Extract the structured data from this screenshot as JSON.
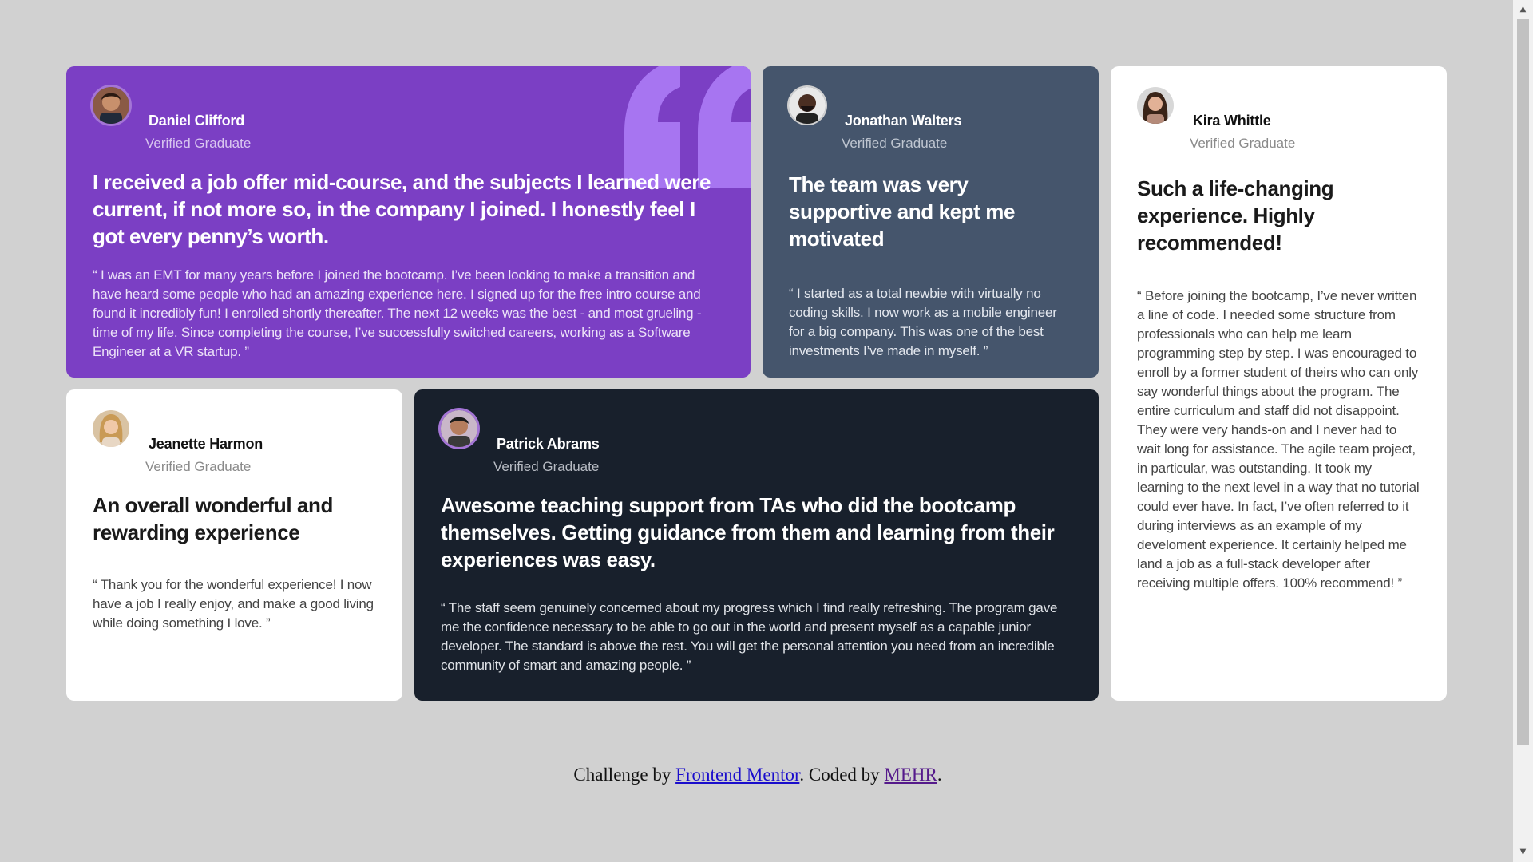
{
  "testimonials": [
    {
      "name": "Daniel Clifford",
      "role": "Verified Graduate",
      "headline": "I received a job offer mid-course, and the subjects I learned were current, if not more so, in the company I joined. I honestly feel I got every penny’s worth.",
      "body": "“ I was an EMT for many years before I joined the bootcamp. I’ve been looking to make a transition and have heard some people who had an amazing experience here. I signed up for the free intro course and found it incredibly fun! I enrolled shortly thereafter. The next 12 weeks was the best - and most grueling - time of my life. Since completing the course, I’ve successfully switched careers, working as a Software Engineer at a VR startup. ”",
      "color": "#7b3fc4"
    },
    {
      "name": "Jonathan Walters",
      "role": "Verified Graduate",
      "headline": "The team was very supportive and kept me motivated",
      "body": "“ I started as a total newbie with virtually no coding skills. I now work as a mobile engineer for a big company. This was one of the best investments I’ve made in myself. ”",
      "color": "#45556c"
    },
    {
      "name": "Kira Whittle",
      "role": "Verified Graduate",
      "headline": "Such a life-changing experience. Highly recommended!",
      "body": "“ Before joining the bootcamp, I’ve never written a line of code. I needed some structure from professionals who can help me learn programming step by step. I was encouraged to enroll by a former student of theirs who can only say wonderful things about the program. The entire curriculum and staff did not disappoint. They were very hands-on and I never had to wait long for assistance. The agile team project, in particular, was outstanding. It took my learning to the next level in a way that no tutorial could ever have. In fact, I’ve often referred to it during interviews as an example of my develoment experience. It certainly helped me land a job as a full-stack developer after receiving multiple offers. 100% recommend! ”",
      "color": "#ffffff"
    },
    {
      "name": "Jeanette Harmon",
      "role": "Verified Graduate",
      "headline": "An overall wonderful and rewarding experience",
      "body": "“ Thank you for the wonderful experience! I now have a job I really enjoy, and make a good living while doing something I love. ”",
      "color": "#ffffff"
    },
    {
      "name": "Patrick Abrams",
      "role": "Verified Graduate",
      "headline": "Awesome teaching support from TAs who did the bootcamp themselves. Getting guidance from them and learning from their experiences was easy.",
      "body": "“ The staff seem genuinely concerned about my progress which I find really refreshing. The program gave me the confidence necessary to be able to go out in the world and present myself as a capable junior developer. The standard is above the rest. You will get the personal attention you need from an incredible community of smart and amazing people. ”",
      "color": "#18202c"
    }
  ],
  "footer": {
    "prefix": "Challenge by ",
    "link1": "Frontend Mentor",
    "middle": ". Coded by ",
    "link2": "MEHR",
    "suffix": "."
  },
  "icons": {
    "quote": "quote-icon",
    "scroll_up": "scroll-up-arrow-icon",
    "scroll_down": "scroll-down-arrow-icon"
  }
}
